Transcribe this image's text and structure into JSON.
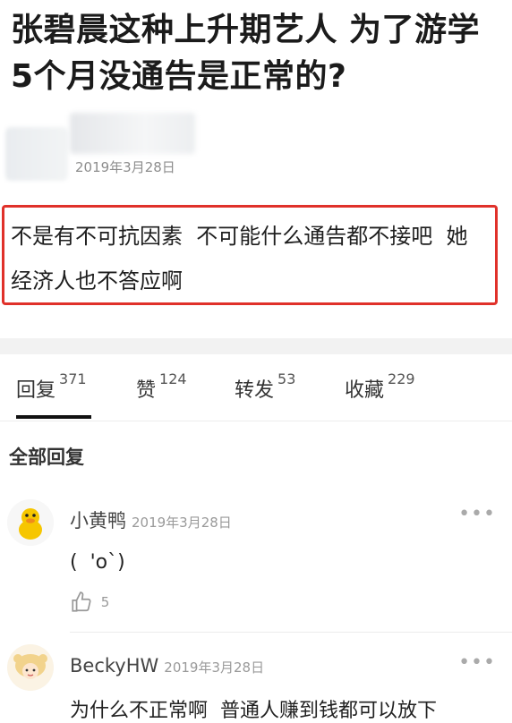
{
  "post": {
    "title": "张碧晨这种上升期艺人 为了游学 5个月没通告是正常的?",
    "date": "2019年3月28日",
    "body": "不是有不可抗因素  不可能什么通告都不接吧  她经济人也不答应啊"
  },
  "tabs": [
    {
      "label": "回复",
      "count": "371"
    },
    {
      "label": "赞",
      "count": "124"
    },
    {
      "label": "转发",
      "count": "53"
    },
    {
      "label": "收藏",
      "count": "229"
    }
  ],
  "section_title": "全部回复",
  "comments": [
    {
      "name": "小黄鸭",
      "date": "2019年3月28日",
      "text": "(  'o`)",
      "likes": "5",
      "avatar_icon": "duck-avatar-icon"
    },
    {
      "name": "BeckyHW",
      "date": "2019年3月28日",
      "text": "为什么不正常啊  普通人赚到钱都可以放下",
      "avatar_icon": "cartoon-avatar-icon"
    }
  ],
  "colors": {
    "highlight_border": "#e0312a",
    "active_tab": "#111111",
    "muted": "#9a9a9a"
  }
}
